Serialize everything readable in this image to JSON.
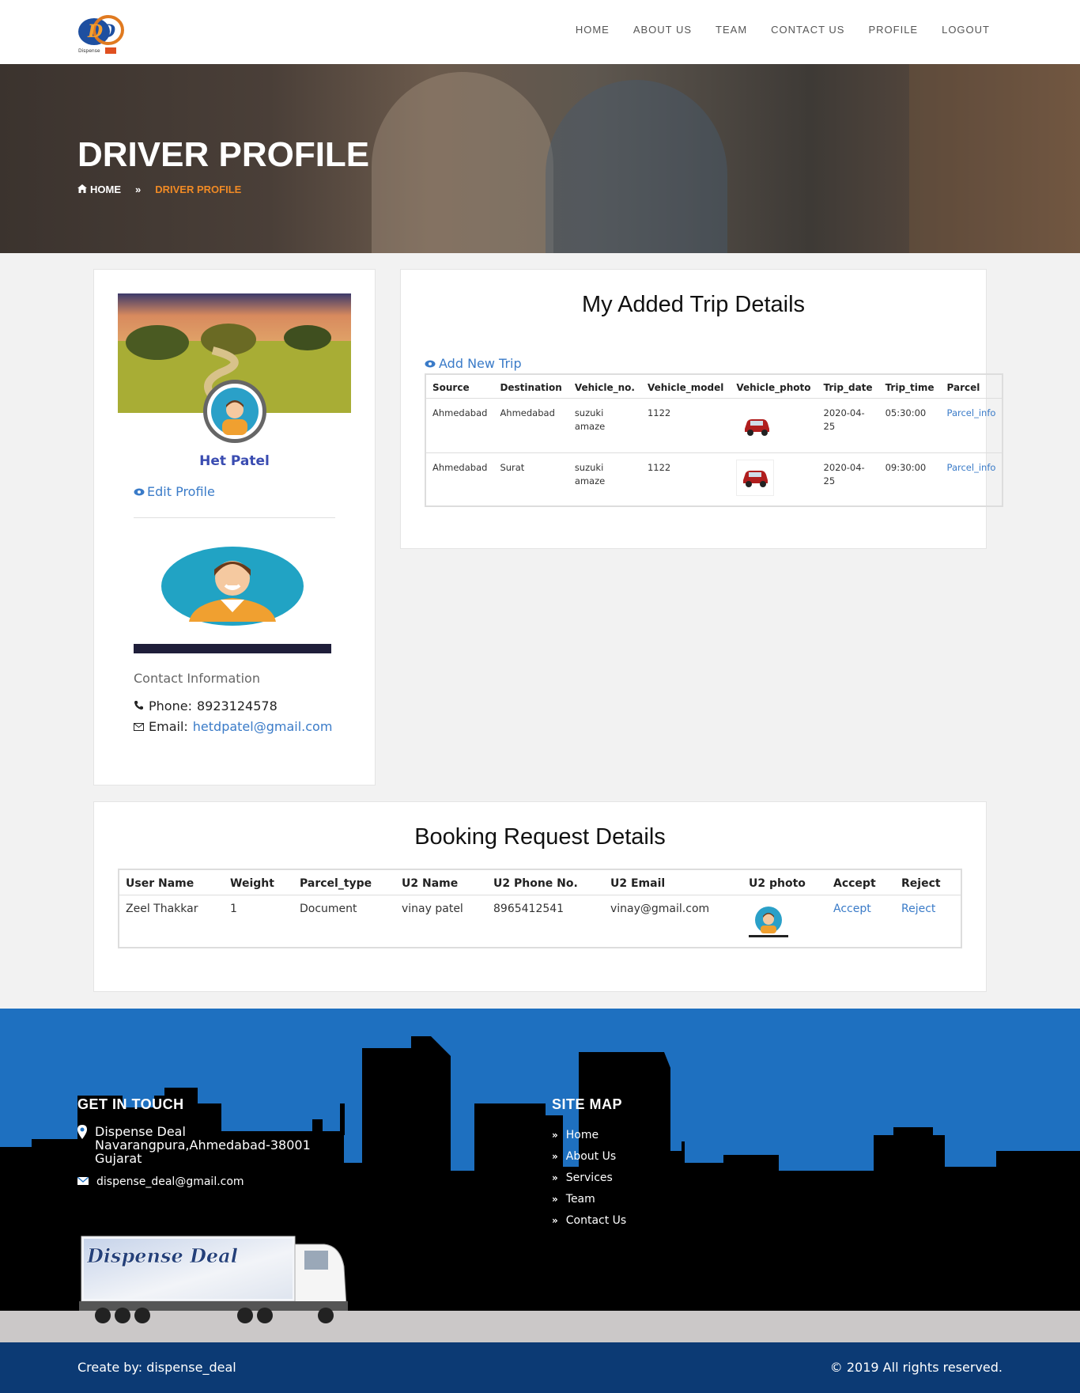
{
  "nav": {
    "logo_text": "Dispense Deal",
    "items": [
      "HOME",
      "ABOUT US",
      "TEAM",
      "CONTACT US",
      "PROFILE",
      "LOGOUT"
    ]
  },
  "hero": {
    "title": "DRIVER PROFILE",
    "breadcrumb_home": "HOME",
    "breadcrumb_sep": "»",
    "breadcrumb_current": "DRIVER PROFILE"
  },
  "profile": {
    "name": "Het Patel",
    "edit_label": "Edit Profile",
    "contact_title": "Contact Information",
    "phone_label": "Phone:",
    "phone": "8923124578",
    "email_label": "Email:",
    "email": "hetdpatel@gmail.com"
  },
  "trips": {
    "title": "My Added Trip Details",
    "add_label": "Add New Trip",
    "columns": [
      "Source",
      "Destination",
      "Vehicle_no.",
      "Vehicle_model",
      "Vehicle_photo",
      "Trip_date",
      "Trip_time",
      "Parcel"
    ],
    "rows": [
      {
        "source": "Ahmedabad",
        "destination": "Ahmedabad",
        "vehicle_no": "suzuki amaze",
        "vehicle_model": "1122",
        "trip_date": "2020-04-25",
        "trip_time": "05:30:00",
        "parcel": "Parcel_info"
      },
      {
        "source": "Ahmedabad",
        "destination": "Surat",
        "vehicle_no": "suzuki amaze",
        "vehicle_model": "1122",
        "trip_date": "2020-04-25",
        "trip_time": "09:30:00",
        "parcel": "Parcel_info"
      }
    ]
  },
  "bookings": {
    "title": "Booking Request Details",
    "columns": [
      "User Name",
      "Weight",
      "Parcel_type",
      "U2 Name",
      "U2 Phone No.",
      "U2 Email",
      "U2 photo",
      "Accept",
      "Reject"
    ],
    "rows": [
      {
        "user_name": "Zeel Thakkar",
        "weight": "1",
        "parcel_type": "Document",
        "u2_name": "vinay patel",
        "u2_phone": "8965412541",
        "u2_email": "vinay@gmail.com",
        "accept": "Accept",
        "reject": "Reject"
      }
    ]
  },
  "footer": {
    "get_in_touch": "GET IN TOUCH",
    "addr1": "Dispense Deal",
    "addr2": "Navarangpura,Ahmedabad-38001",
    "addr3": "Gujarat",
    "email": "dispense_deal@gmail.com",
    "site_map": "SITE MAP",
    "links": [
      "Home",
      "About Us",
      "Services",
      "Team",
      "Contact Us"
    ],
    "truck_text": "Dispense Deal",
    "created_by": "Create by: dispense_deal",
    "copyright": "© 2019 All rights reserved."
  },
  "colors": {
    "accent": "#3a7bc8",
    "orange": "#f08a25",
    "footer_blue": "#1e70c0",
    "bottom_bar": "#0c3a74"
  }
}
